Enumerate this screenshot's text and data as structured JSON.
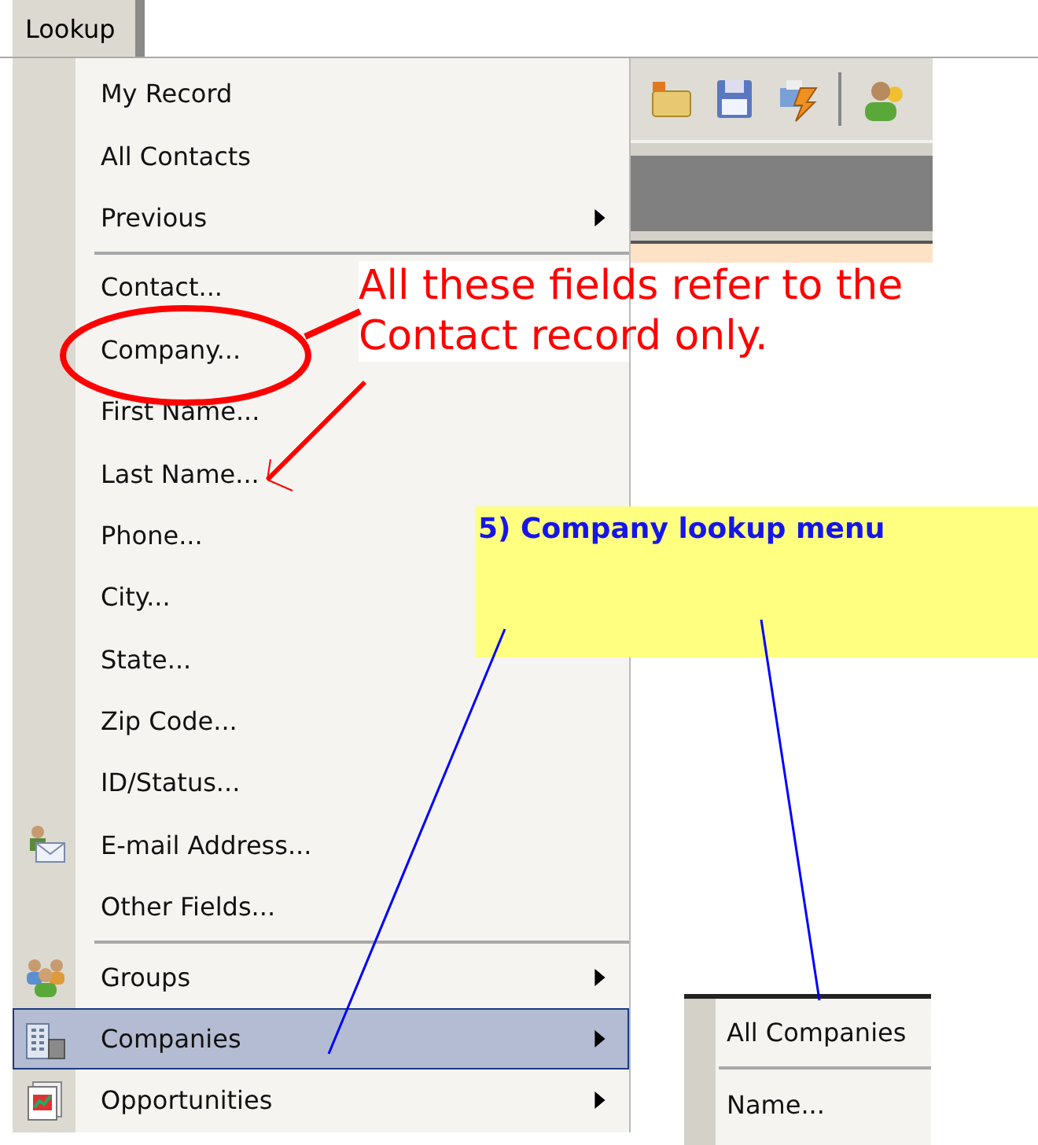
{
  "menu_bar": {
    "label": "Lookup"
  },
  "menu": [
    {
      "kind": "item",
      "label": "My Record"
    },
    {
      "kind": "item",
      "label": "All Contacts"
    },
    {
      "kind": "submenu",
      "label": "Previous"
    },
    {
      "kind": "separator"
    },
    {
      "kind": "item",
      "label": "Contact..."
    },
    {
      "kind": "item",
      "label": "Company..."
    },
    {
      "kind": "item",
      "label": "First Name..."
    },
    {
      "kind": "item",
      "label": "Last Name..."
    },
    {
      "kind": "item",
      "label": "Phone..."
    },
    {
      "kind": "item",
      "label": "City..."
    },
    {
      "kind": "item",
      "label": "State..."
    },
    {
      "kind": "item",
      "label": "Zip Code..."
    },
    {
      "kind": "item",
      "label": "ID/Status..."
    },
    {
      "kind": "item",
      "label": "E-mail Address..."
    },
    {
      "kind": "item",
      "label": "Other Fields..."
    },
    {
      "kind": "separator"
    },
    {
      "kind": "submenu",
      "label": "Groups",
      "selected": false
    },
    {
      "kind": "submenu",
      "label": "Companies",
      "selected": true
    },
    {
      "kind": "submenu",
      "label": "Opportunities",
      "selected": false
    }
  ],
  "submenu": [
    {
      "kind": "item",
      "label": "All Companies"
    },
    {
      "kind": "separator"
    },
    {
      "kind": "item",
      "label": "Name..."
    }
  ],
  "annotations": {
    "note": "All these fields refer to the Contact record only.",
    "callout": "5) Company lookup menu"
  }
}
